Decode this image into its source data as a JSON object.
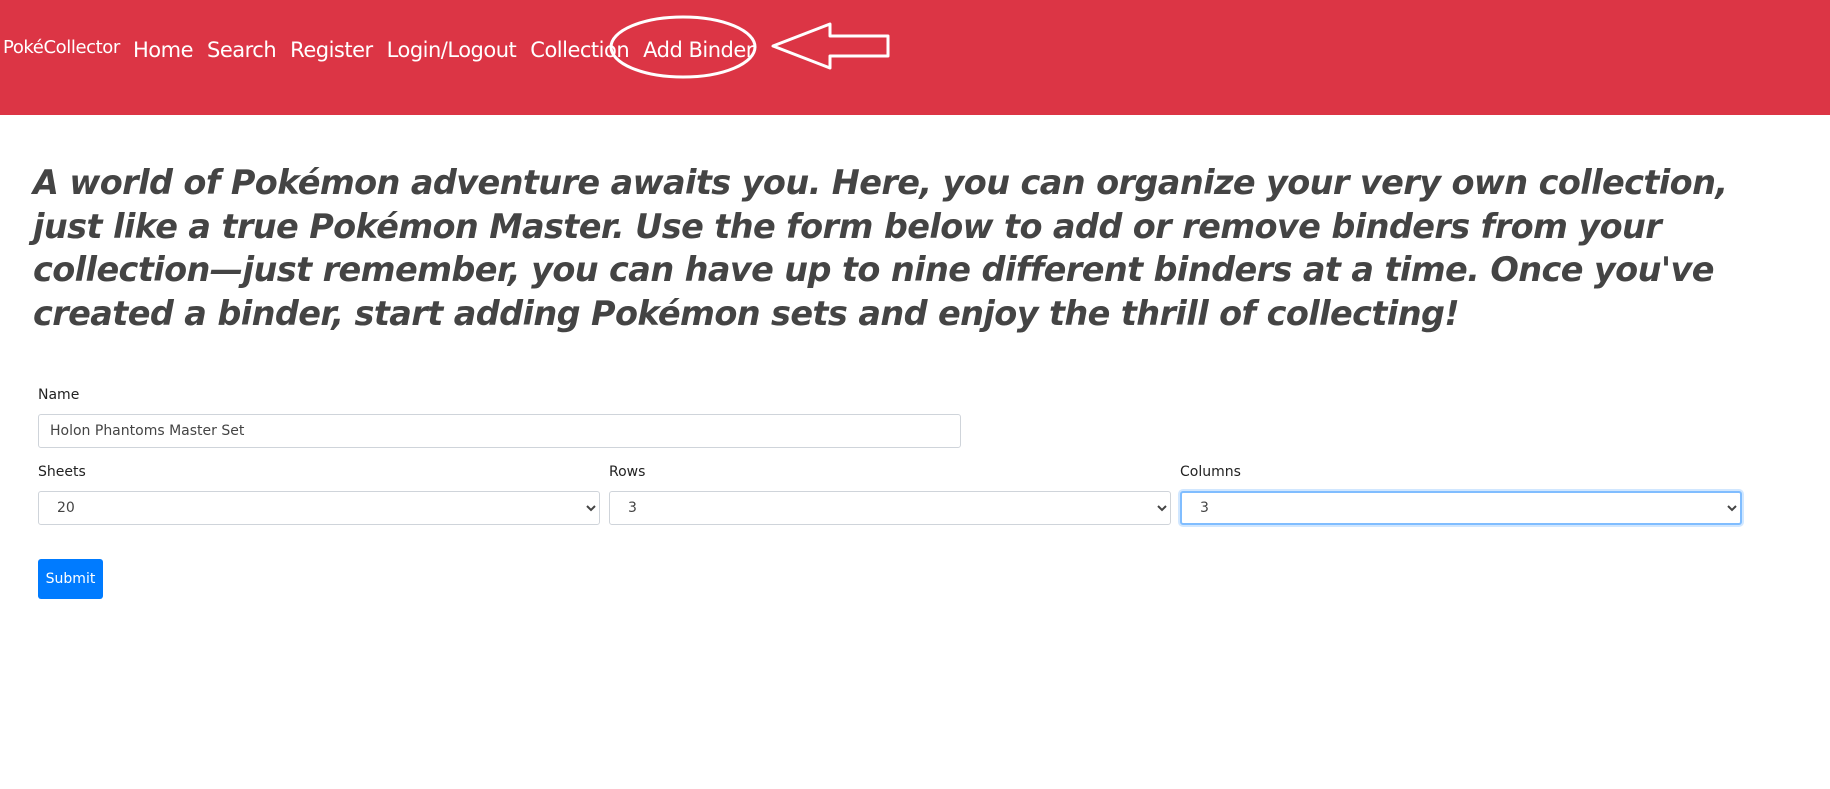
{
  "navbar": {
    "brand": "PokéCollector",
    "links": [
      "Home",
      "Search",
      "Register",
      "Login/Logout",
      "Collection",
      "Add Binder"
    ],
    "accent_color": "#dc3545"
  },
  "intro": {
    "text": "A world of Pokémon adventure awaits you. Here, you can organize your very own collection, just like a true Pokémon Master. Use the form below to add or remove binders from your collection—just remember, you can have up to nine different binders at a time. Once you've created a binder, start adding Pokémon sets and enjoy the thrill of collecting!"
  },
  "form": {
    "name_label": "Name",
    "name_value": "Holon Phantoms Master Set",
    "sheets_label": "Sheets",
    "sheets_value": "20",
    "rows_label": "Rows",
    "rows_value": "3",
    "columns_label": "Columns",
    "columns_value": "3",
    "submit_label": "Submit",
    "submit_color": "#007bff"
  },
  "annotation": {
    "highlighted_link": "Add Binder",
    "icons": [
      "ellipse-highlight",
      "arrow-left-icon"
    ]
  }
}
